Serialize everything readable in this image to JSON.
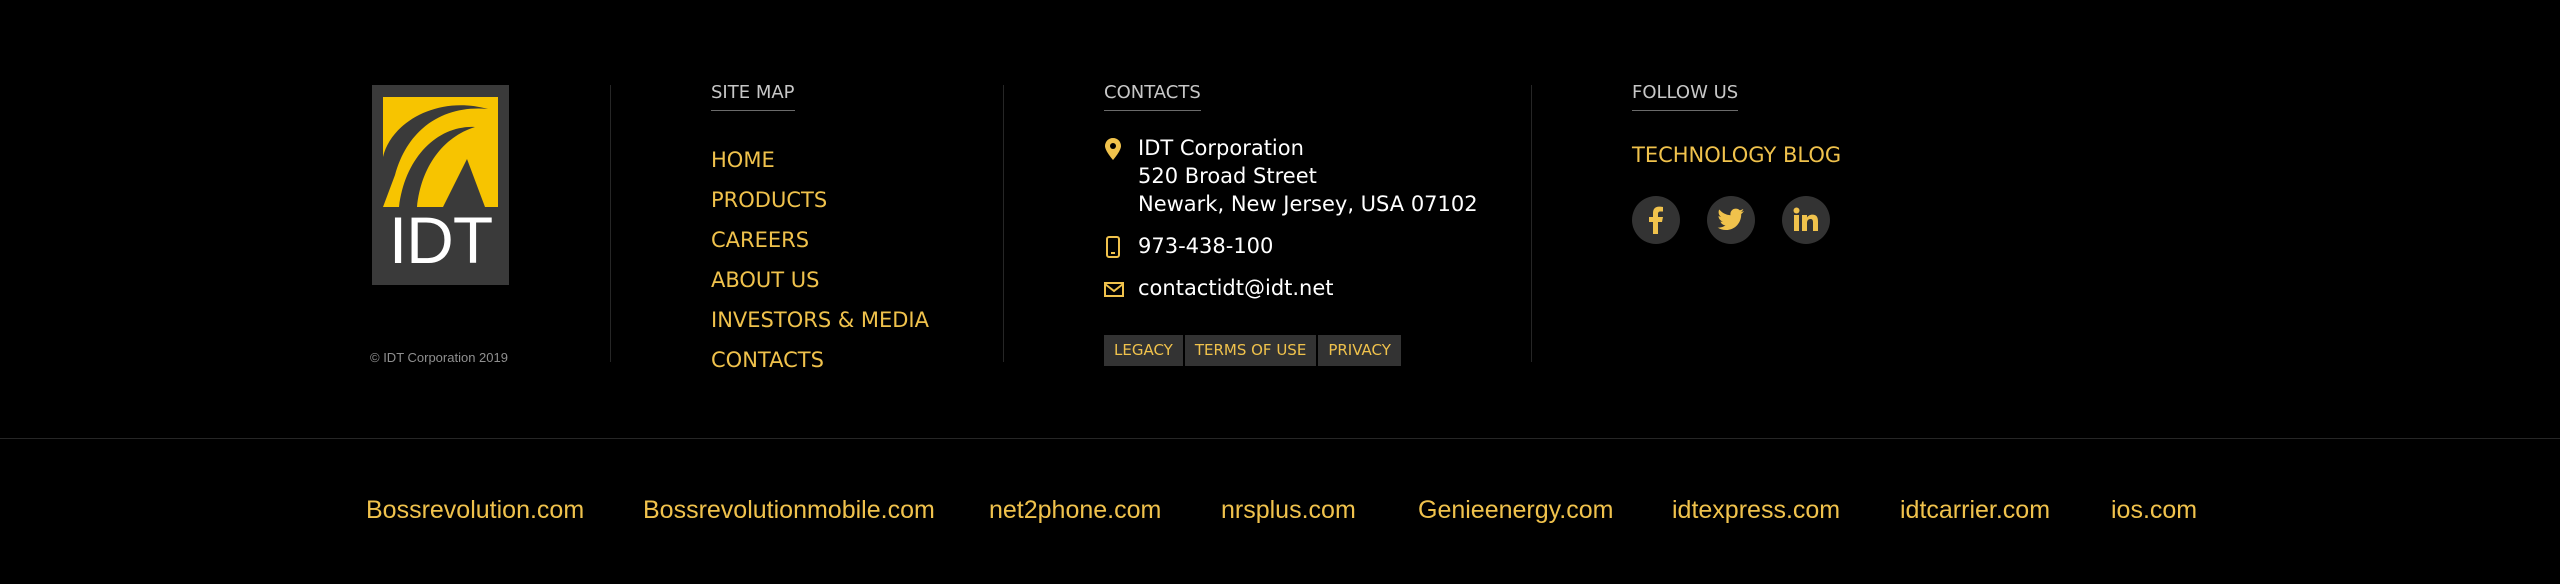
{
  "logo": {
    "word": "IDT",
    "icon": "idt-logo-icon"
  },
  "copyright": "© IDT Corporation 2019",
  "site_map": {
    "title": "SITE MAP",
    "items": [
      "HOME",
      "PRODUCTS",
      "CAREERS",
      "ABOUT US",
      "INVESTORS & MEDIA",
      "CONTACTS"
    ]
  },
  "contacts": {
    "title": "CONTACTS",
    "company": "IDT Corporation",
    "street": "520 Broad Street",
    "city": "Newark, New Jersey, USA 07102",
    "phone": "973-438-100",
    "email": "contactidt@idt.net",
    "icons": [
      "location-pin-icon",
      "phone-icon",
      "mail-icon"
    ],
    "legal": [
      "LEGACY",
      "TERMS OF USE",
      "PRIVACY"
    ]
  },
  "follow": {
    "title": "FOLLOW US",
    "blog": "TECHNOLOGY BLOG",
    "social": [
      "facebook-icon",
      "twitter-icon",
      "linkedin-icon"
    ]
  },
  "sites": [
    "Bossrevolution.com",
    "Bossrevolutionmobile.com",
    "net2phone.com",
    "nrsplus.com",
    "Genieenergy.com",
    "idtexpress.com",
    "idtcarrier.com",
    "ios.com"
  ],
  "colors": {
    "background": "#000000",
    "accent": "#f0c24c",
    "logo_yellow": "#f7c400",
    "panel": "#333333"
  }
}
